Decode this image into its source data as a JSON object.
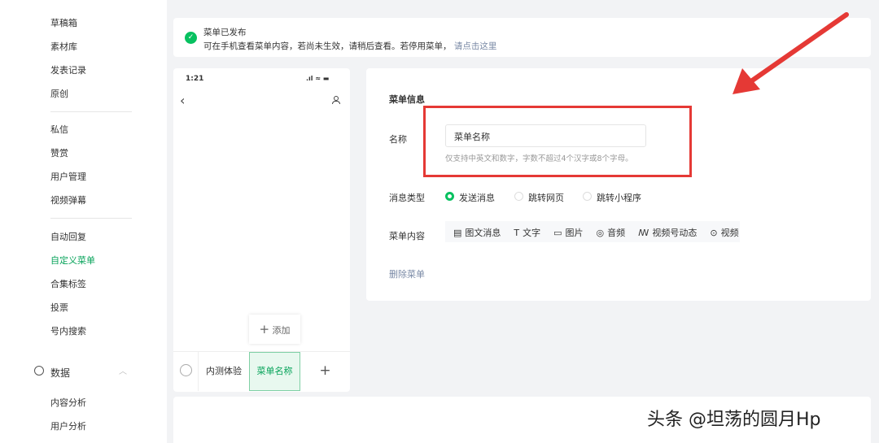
{
  "sidebar": {
    "items": [
      "草稿箱",
      "素材库",
      "发表记录",
      "原创",
      "私信",
      "赞赏",
      "用户管理",
      "视频弹幕",
      "自动回复",
      "自定义菜单",
      "合集标签",
      "投票",
      "号内搜索"
    ],
    "section": "数据",
    "sub_items": [
      "内容分析",
      "用户分析"
    ]
  },
  "notice": {
    "title": "菜单已发布",
    "text": "可在手机查看菜单内容，若尚未生效，请稍后查看。若停用菜单，",
    "link": "请点击这里"
  },
  "phone": {
    "time": "1:21",
    "add": "添加",
    "menus": [
      "内测体验",
      "菜单名称"
    ],
    "plus": "+"
  },
  "form": {
    "heading": "菜单信息",
    "name_label": "名称",
    "name_value": "菜单名称",
    "name_hint": "仅支持中英文和数字，字数不超过4个汉字或8个字母。",
    "type_label": "消息类型",
    "types": [
      "发送消息",
      "跳转网页",
      "跳转小程序"
    ],
    "content_label": "菜单内容",
    "content_tools": [
      "图文消息",
      "文字",
      "图片",
      "音频",
      "视频号动态",
      "视频"
    ],
    "delete": "删除菜单"
  },
  "watermark": "头条 @坦荡的圆月Hp",
  "colors": {
    "accent": "#07c160",
    "highlight": "#e53935"
  }
}
